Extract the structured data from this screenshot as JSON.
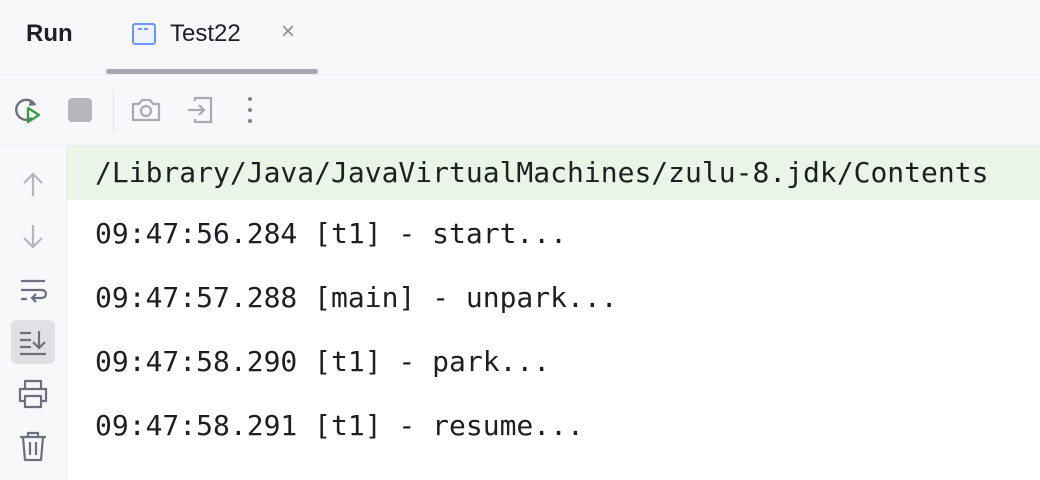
{
  "header": {
    "title": "Run",
    "tab": {
      "label": "Test22",
      "icon": "run-config-icon"
    }
  },
  "toolbar": {
    "buttons": [
      "rerun-icon",
      "stop-icon",
      "screenshot-icon",
      "exit-icon",
      "more-icon"
    ]
  },
  "gutter": {
    "buttons": [
      "arrow-up-icon",
      "arrow-down-icon",
      "soft-wrap-icon",
      "scroll-to-end-icon",
      "print-icon",
      "trash-icon"
    ]
  },
  "console": {
    "command": "/Library/Java/JavaVirtualMachines/zulu-8.jdk/Contents",
    "lines": [
      "09:47:56.284 [t1] - start...",
      "09:47:57.288 [main] - unpark...",
      "09:47:58.290 [t1] - park...",
      "09:47:58.291 [t1] - resume..."
    ]
  },
  "colors": {
    "command_bg": "#e9f5e6",
    "rerun_green": "#3d9a4c",
    "tab_icon_blue": "#6f96f2"
  }
}
